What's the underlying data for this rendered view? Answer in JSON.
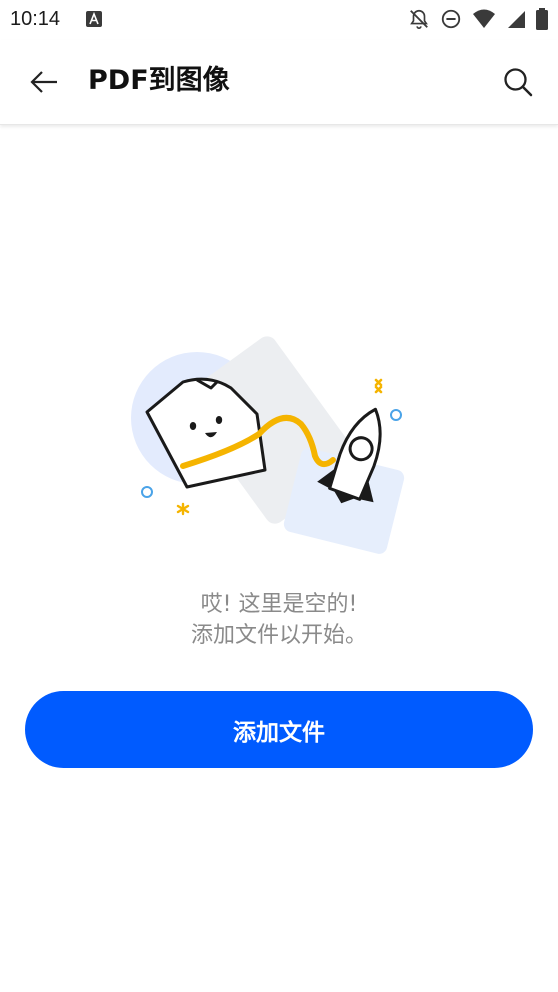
{
  "status_bar": {
    "time": "10:14",
    "icons": [
      "font-notification-icon",
      "bell-off-icon",
      "do-not-disturb-icon",
      "wifi-icon",
      "cellular-signal-icon",
      "battery-icon"
    ]
  },
  "app_bar": {
    "title": "PDF到图像",
    "back_icon": "arrow-left-icon",
    "search_icon": "search-icon"
  },
  "empty_state": {
    "line1": "哎! 这里是空的!",
    "line2": "添加文件以开始。",
    "illustration": "paper-astronaut-with-rocket"
  },
  "add_button": {
    "label": "添加文件"
  },
  "colors": {
    "primary": "#005bff",
    "muted_text": "#8a8a8a",
    "accent_yellow": "#f5b400",
    "accent_blue": "#4aa3e8"
  }
}
